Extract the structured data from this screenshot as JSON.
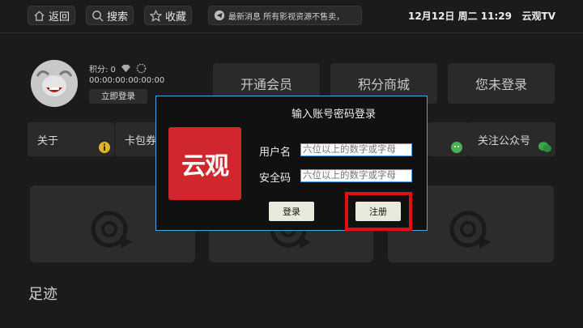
{
  "topbar": {
    "back_label": "返回",
    "search_label": "搜索",
    "favorites_label": "收藏",
    "news_text": "最新消息  所有影视资源不售卖，",
    "datetime": "12月12日 周二 11:29",
    "app_name": "云观TV"
  },
  "profile": {
    "points": "积分: 0",
    "id": "00:00:00:00:00:00",
    "login_now": "立即登录"
  },
  "main_buttons": {
    "vip": "开通会员",
    "points_mall": "积分商城",
    "not_logged_in": "您未登录"
  },
  "row2": {
    "about": "关于",
    "card": "卡包券",
    "follow": "关注公众号"
  },
  "footprint_label": "足迹",
  "dialog": {
    "title": "输入账号密码登录",
    "logo_text": "云观",
    "username_label": "用户名",
    "username_placeholder": "六位以上的数字或字母",
    "password_label": "安全码",
    "password_placeholder": "六位以上的数字或字母",
    "login_button": "登录",
    "register_button": "注册"
  },
  "colors": {
    "accent_border": "#4da3e0",
    "logo_red": "#d0262e",
    "highlight_red": "#e01010"
  }
}
